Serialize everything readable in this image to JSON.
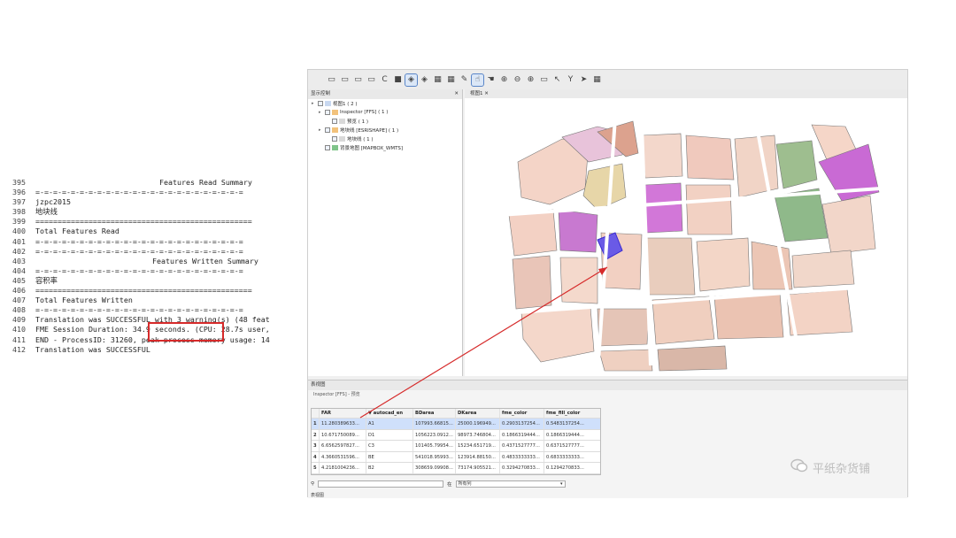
{
  "log": {
    "lines": [
      {
        "num": "395",
        "text": "Features Read Summary",
        "style": "center"
      },
      {
        "num": "396",
        "text": "=-=-=-=-=-=-=-=-=-=-=-=-=-=-=-=-=-=-=-=-=-=-=-=",
        "style": ""
      },
      {
        "num": "397",
        "text": "jzpc2015",
        "style": ""
      },
      {
        "num": "398",
        "text": "地块线",
        "style": ""
      },
      {
        "num": "399",
        "text": "=================================================",
        "style": ""
      },
      {
        "num": "400",
        "text": "Total Features Read",
        "style": ""
      },
      {
        "num": "401",
        "text": "=-=-=-=-=-=-=-=-=-=-=-=-=-=-=-=-=-=-=-=-=-=-=-=",
        "style": ""
      },
      {
        "num": "402",
        "text": "=-=-=-=-=-=-=-=-=-=-=-=-=-=-=-=-=-=-=-=-=-=-=-=",
        "style": ""
      },
      {
        "num": "403",
        "text": "Features Written Summary",
        "style": "center2"
      },
      {
        "num": "404",
        "text": "=-=-=-=-=-=-=-=-=-=-=-=-=-=-=-=-=-=-=-=-=-=-=-=",
        "style": ""
      },
      {
        "num": "405",
        "text": "容积率",
        "style": ""
      },
      {
        "num": "406",
        "text": "=================================================",
        "style": ""
      },
      {
        "num": "407",
        "text": "Total Features Written",
        "style": ""
      },
      {
        "num": "408",
        "text": "=-=-=-=-=-=-=-=-=-=-=-=-=-=-=-=-=-=-=-=-=-=-=-=",
        "style": ""
      },
      {
        "num": "409",
        "text": "Translation was SUCCESSFUL with 3 warning(s) (48 feat",
        "style": ""
      },
      {
        "num": "410",
        "text": "FME Session Duration: 34.9 seconds. (CPU: 28.7s user,",
        "style": ""
      },
      {
        "num": "411",
        "text": "END - ProcessID: 31260, peak process memory usage: 14",
        "style": ""
      },
      {
        "num": "412",
        "text": "Translation was SUCCESSFUL",
        "style": ""
      }
    ],
    "highlight": "34.9 seconds."
  },
  "toolbar": {
    "buttons": [
      "▭",
      "▭",
      "▭",
      "▭",
      "C",
      "■",
      "◈",
      "◈",
      "▦",
      "▦",
      "✎",
      "☝",
      "☚",
      "⊕",
      "⊖",
      "⊕",
      "▭",
      "↖",
      "Y",
      "➤",
      "▦"
    ]
  },
  "layers": {
    "title": "显示控制",
    "items": [
      {
        "label": "视图1 ( 2 )",
        "indent": 0
      },
      {
        "label": "Inspector [FFS] ( 1 )",
        "indent": 1
      },
      {
        "label": "预览 ( 1 )",
        "indent": 2
      },
      {
        "label": "地块线 [ESRISHAPE] ( 1 )",
        "indent": 1
      },
      {
        "label": "地块线 ( 1 )",
        "indent": 2
      },
      {
        "label": "背景地图 [MAPBOX_WMTS]",
        "indent": 1
      }
    ]
  },
  "map": {
    "tab_label": "视图1"
  },
  "bottom": {
    "title": "表视图",
    "breadcrumb": "Inspector [FFS] - 预览",
    "columns": [
      "",
      "FAR",
      "▼ autocad_en",
      "BDarea",
      "DKarea",
      "fme_color",
      "fme_fill_color"
    ],
    "rows": [
      [
        "1",
        "11.280389633...",
        "A1",
        "107993.66815...",
        "25000.196949...",
        "0.2903137254...",
        "0.5483137254..."
      ],
      [
        "2",
        "10.671750089...",
        "D1",
        "1056223.0912...",
        "98973.746804...",
        "0.1866319444...",
        "0.1866319444..."
      ],
      [
        "3",
        "6.6562597827...",
        "C3",
        "101405.79954...",
        "15234.651719...",
        "0.4371527777...",
        "0.6371527777..."
      ],
      [
        "4",
        "4.3660531596...",
        "BE",
        "541018.95993...",
        "123914.88150...",
        "0.4833333333...",
        "0.6833333333..."
      ],
      [
        "5",
        "4.2181004236...",
        "B2",
        "308659.09908...",
        "73174.905521...",
        "0.3294270833...",
        "0.1294270833..."
      ]
    ],
    "search_placeholder": "",
    "filter_value": "所有列",
    "status_tab": "表视图"
  },
  "watermark": "平纸杂货铺",
  "colors": {
    "highlight": "#d62a2a",
    "selected_row": "#cfe0fb",
    "accent": "#5a86c8"
  }
}
